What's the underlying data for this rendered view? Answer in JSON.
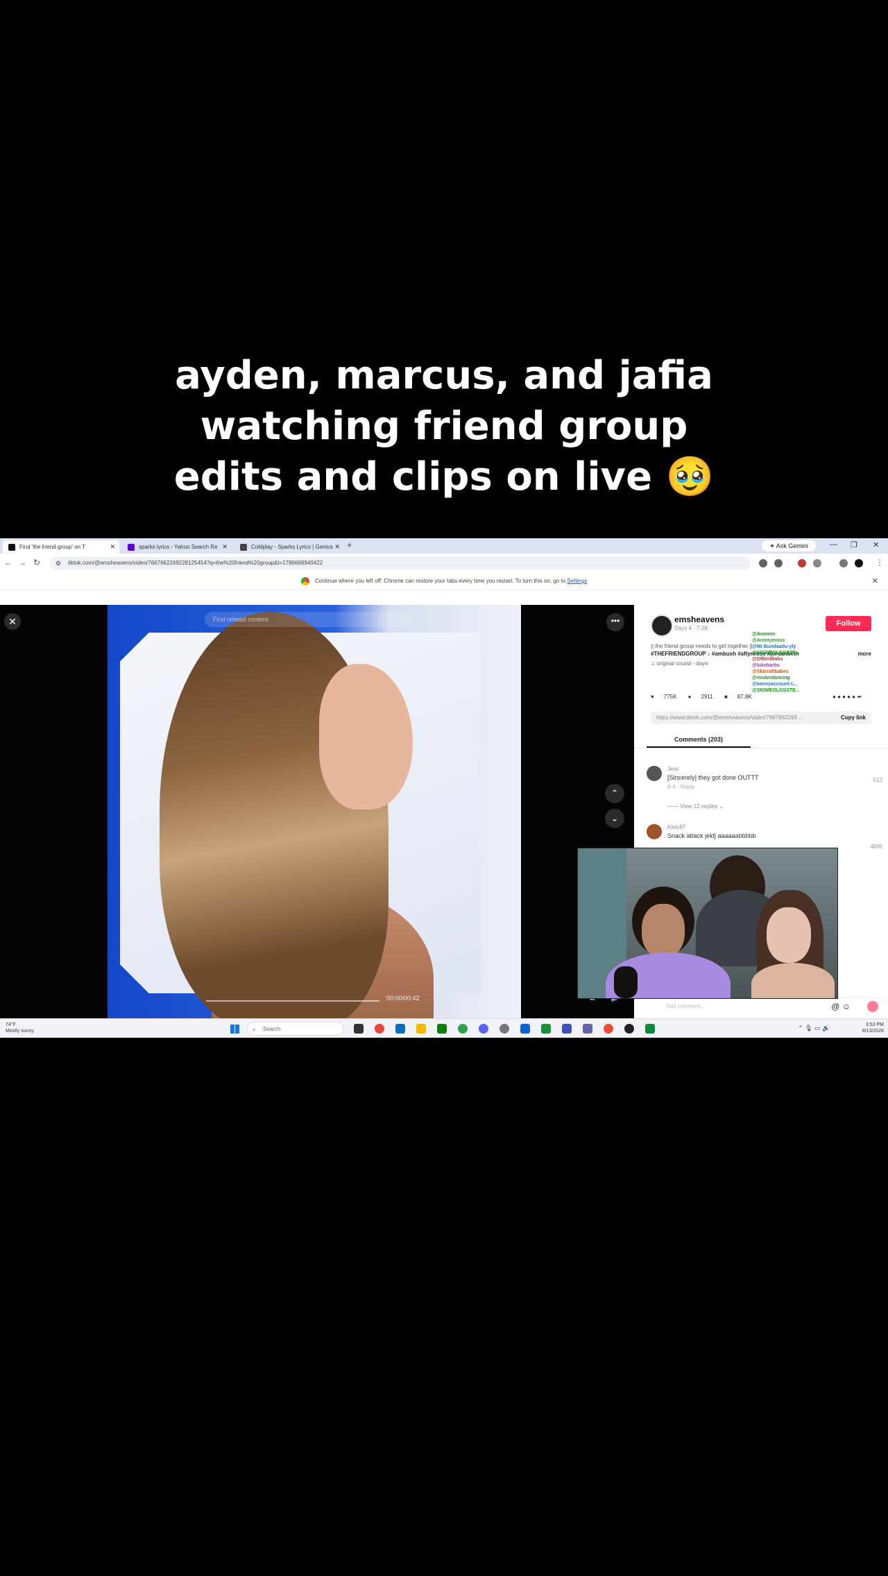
{
  "caption": {
    "line1": "ayden, marcus, and jafia",
    "line2": "watching friend group",
    "line3": "edits and clips on live 🥹"
  },
  "browser": {
    "tabs": [
      {
        "label": "Find 'the friend group' on T",
        "fav_color": "#111111",
        "active": true
      },
      {
        "label": "sparks lyrics - Yahoo Search Re",
        "fav_color": "#6001d2",
        "active": false
      },
      {
        "label": "Coldplay - Sparks Lyrics | Genius",
        "fav_color": "#444444",
        "active": false
      }
    ],
    "new_tab": "+",
    "ask_gemini": "✦ Ask Gemini",
    "url": "tiktok.com/@emsheavens/video/7667662269228125454?q=the%20friend%20group&t=1786668940422",
    "restore_text": "Continue where you left off: Chrome can restore your tabs every time you restart. To turn this on, go to",
    "restore_link": "Settings"
  },
  "video": {
    "search_placeholder": "Find related content",
    "timecode": "00:00/00:42"
  },
  "sidebar": {
    "username": "emsheavens",
    "meta": "Days 4 · 7-28",
    "follow_label": "Follow",
    "description": "|| the friend group needs to get together ||",
    "hashtags": "#THEFRIENDGROUP ♪ #ambush #aftynrose #jordanbeth",
    "more": "more",
    "sound": "♫ original sound - daya",
    "stats": {
      "likes": "775K",
      "comments": "2911",
      "saves": "87.8K"
    },
    "link": "https://www.tiktok.com/@emsheavens/video/7667662269...",
    "copy_link": "Copy link",
    "comments_tab": "Comments (203)",
    "comments": [
      {
        "name": "Jess",
        "text": "[Sincerely] they got done OUTTT",
        "date": "6-4 · Reply",
        "likes": "513"
      },
      {
        "name": "Kiely97",
        "text": "Snack attack jekfj aaaaaabbbbb",
        "date": "",
        "likes": "4896"
      }
    ],
    "view_replies": "—— View 12 replies ⌄",
    "add_comment": "Add comment...",
    "chat": [
      {
        "text": "@Anonnn",
        "color": "#1f8a1f"
      },
      {
        "text": "@Anonymous",
        "color": "#2aa52a"
      },
      {
        "text": "@Mr.Bundaadu-yly",
        "color": "#1f6fd1"
      },
      {
        "text": "@SIGMEOLGSSTE...",
        "color": "#1f8a1f"
      },
      {
        "text": "@DfBenBabs",
        "color": "#c0392b"
      },
      {
        "text": "@lukebarbs",
        "color": "#8e44ad"
      },
      {
        "text": "@Skicraftbabes",
        "color": "#d35400"
      },
      {
        "text": "@misterdancing",
        "color": "#1f8a1f"
      },
      {
        "text": "@kennyaccount-t...",
        "color": "#1f6fd1"
      },
      {
        "text": "@SIGMEOLGSSTE...",
        "color": "#1f8a1f"
      }
    ]
  },
  "taskbar": {
    "weather_temp": "74°F",
    "weather_desc": "Mostly sunny",
    "search_label": "Search",
    "time": "3:53 PM",
    "date": "8/13/2026"
  },
  "colors": {
    "follow": "#fe2c55",
    "video_bg": "#1448c9",
    "taskbar": "#f2f3f8"
  }
}
